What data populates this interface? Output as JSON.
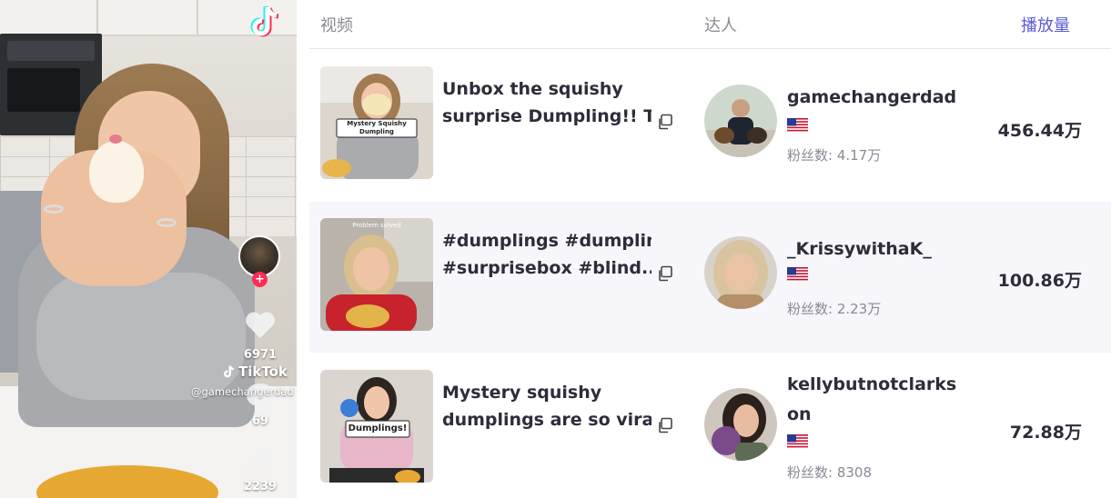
{
  "video_preview": {
    "brand": "TikTok",
    "username": "@gamechangerdad",
    "likes": "6971",
    "comments": "69",
    "shares": "2239",
    "icons": [
      "tiktok-logo-icon",
      "heart-icon",
      "comment-icon",
      "share-icon",
      "follow-plus-icon"
    ]
  },
  "table": {
    "headers": {
      "video": "视频",
      "creator": "达人",
      "plays": "播放量"
    },
    "rows": [
      {
        "title_line1": "Unbox the squishy",
        "title_line2": "surprise Dumpling!! Th...",
        "thumb_caption": "Mystery Squishy Dumpling",
        "creator_name": "gamechangerdad",
        "creator_name_line2": "",
        "country_flag": "us-flag-icon",
        "fans": "粉丝数: 4.17万",
        "plays": "456.44万"
      },
      {
        "title_line1": "#dumplings #dumpling",
        "title_line2": "#surprisebox #blind...",
        "thumb_caption": "Problem solved",
        "creator_name": "_KrissywithaK_",
        "creator_name_line2": "",
        "country_flag": "us-flag-icon",
        "fans": "粉丝数: 2.23万",
        "plays": "100.86万"
      },
      {
        "title_line1": "Mystery squishy",
        "title_line2": "dumplings are so viral I...",
        "thumb_caption": "Dumplings!",
        "creator_name": "kellybutnotclarks",
        "creator_name_line2": "on",
        "country_flag": "us-flag-icon",
        "fans": "粉丝数: 8308",
        "plays": "72.88万"
      }
    ]
  },
  "colors": {
    "accent": "#5b5bd6",
    "header_text": "#8a8a96",
    "body_text": "#2d2d3a",
    "row_alt_bg": "#f6f6fb",
    "tiktok_red": "#fe2c55",
    "tiktok_cyan": "#25f4ee"
  }
}
